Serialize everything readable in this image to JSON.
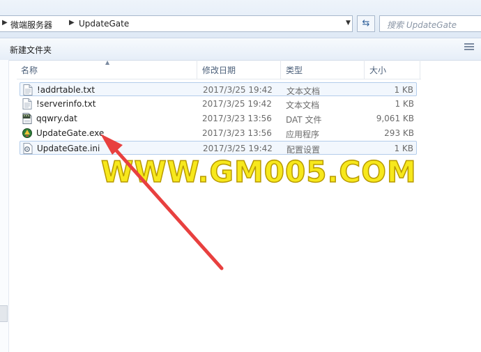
{
  "address_bar": {
    "breadcrumb": [
      "微端服务器",
      "UpdateGate"
    ],
    "search_placeholder": "搜索 UpdateGate"
  },
  "toolbar": {
    "new_folder_label": "新建文件夹"
  },
  "columns": {
    "name": "名称",
    "modified": "修改日期",
    "type": "类型",
    "size": "大小"
  },
  "files": [
    {
      "name": "!addrtable.txt",
      "modified": "2017/3/25 19:42",
      "type": "文本文档",
      "size": "1 KB",
      "icon": "text-file-icon"
    },
    {
      "name": "!serverinfo.txt",
      "modified": "2017/3/25 19:42",
      "type": "文本文档",
      "size": "1 KB",
      "icon": "text-file-icon"
    },
    {
      "name": "qqwry.dat",
      "modified": "2017/3/23 13:56",
      "type": "DAT 文件",
      "size": "9,061 KB",
      "icon": "dat-file-icon"
    },
    {
      "name": "UpdateGate.exe",
      "modified": "2017/3/23 13:56",
      "type": "应用程序",
      "size": "293 KB",
      "icon": "exe-app-icon"
    },
    {
      "name": "UpdateGate.ini",
      "modified": "2017/3/25 19:42",
      "type": "配置设置",
      "size": "1 KB",
      "icon": "ini-settings-icon"
    }
  ],
  "watermark": "WWW.GM005.COM",
  "colors": {
    "arrow": "#e8403f",
    "watermark": "#f7e81c",
    "selection": "#b3ccea"
  }
}
